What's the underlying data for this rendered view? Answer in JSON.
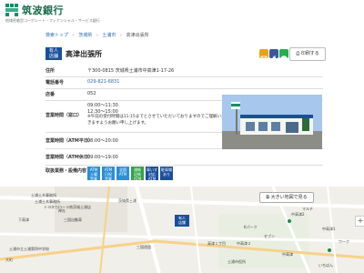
{
  "header": {
    "logo_text": "筑波銀行",
    "logo_sub": "地域密着型コーポレート・フィナンシャル・サービス銀行",
    "colors": {
      "brand": "#0a8f6a"
    }
  },
  "breadcrumb": {
    "items": [
      "検索トップ",
      "茨城県",
      "土浦市",
      "高津出張所"
    ]
  },
  "branch": {
    "badge_line1": "有人",
    "badge_line2": "店舗",
    "name": "高津出張所",
    "print_label": "印刷する",
    "share_icons": [
      "mail-icon",
      "facebook-icon",
      "line-icon"
    ]
  },
  "info": {
    "address_label": "住所",
    "address_value": "〒300-0815 茨城県土浦市中高津1-17-26",
    "phone_label": "電話番号",
    "phone_value": "029-821-6831",
    "store_no_label": "店番",
    "store_no_value": "052",
    "hours_label": "営業時間（窓口）",
    "hours_line1": "09:00～11:30",
    "hours_line2": "12:30～15:00",
    "hours_note1": "※午前の受付時間は11:15までとさせていただいておりますのでご理解いただ",
    "hours_note2": "きますようお願い申し上げます。",
    "atm_weekday_label": "営業時間（ATM平日）",
    "atm_weekday_value": "08:00～20:00",
    "atm_holiday_label": "営業時間（ATM休日）",
    "atm_holiday_value": "09:00～19:00",
    "services_label": "取扱業務・設備内容",
    "services": [
      {
        "line1": "ATM",
        "line2": "土曜",
        "line3": "営業",
        "color": "#2b8fd6"
      },
      {
        "line1": "ATM",
        "line2": "日祝",
        "line3": "営業",
        "color": "#2b8fd6"
      },
      {
        "line1": "全国",
        "line2": "",
        "line3": "ATM",
        "color": "#2b8fd6"
      },
      {
        "line1": "通帳",
        "line2": "記帳",
        "line3": "ATM",
        "color": "#33a24a"
      },
      {
        "line1": "車いす",
        "line2": "対応",
        "line3": "ATM",
        "color": "#1b4f9a"
      },
      {
        "line1": "駐車場",
        "line2": "あり",
        "line3": "",
        "color": "#1b4f9a"
      }
    ]
  },
  "map": {
    "larger_map_label": "大きい地図で見る",
    "zoom_in": "+",
    "marker_line1": "有人",
    "marker_line2": "店舗",
    "labels": {
      "l1": "土浦土木事務所",
      "l2": "土浦土木事務所",
      "l3": "茨城県土浦",
      "l4": "トヨタカローラ南茨城土浦店",
      "l5": "神社",
      "l6": "下高津",
      "l7": "三国自動車",
      "l8": "中高津1",
      "l9": "中高津２",
      "l10": "下高津小",
      "l11": "マルチ",
      "l12": "中高津2",
      "l13": "高津１丁目",
      "l14": "三国遊園",
      "l15": "土浦市立土浦第四中学校",
      "l16": "土浦市役所",
      "l17": "大町",
      "l18": "中高津",
      "l19": "Kパーク",
      "l20": "セブン",
      "l21": "いちばん",
      "l22": "ワーク"
    }
  }
}
